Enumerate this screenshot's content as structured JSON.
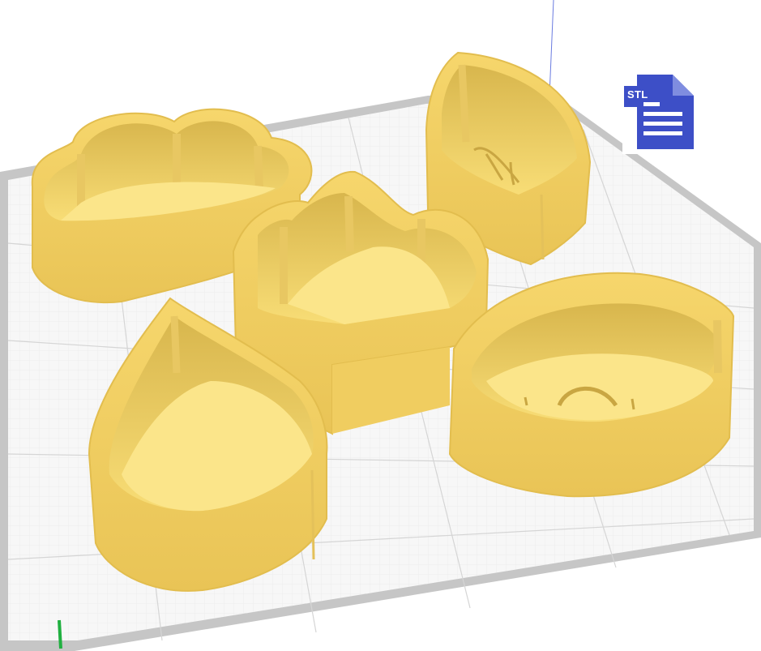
{
  "viewport": {
    "background": "#ffffff",
    "build_plate_color": "#c9c9c9",
    "grid_line_color": "#e8e8e8",
    "model_color": "#f6d66c",
    "model_shadow_color": "#d7b347",
    "axis_colors": {
      "x": "#e03030",
      "y": "#2050e0",
      "z": "#20b040"
    }
  },
  "models": [
    {
      "name": "cloud-cutter"
    },
    {
      "name": "leaf-cutter"
    },
    {
      "name": "tulip-cutter"
    },
    {
      "name": "teardrop-cutter"
    },
    {
      "name": "eye-cutter"
    }
  ],
  "file_badge": {
    "label": "STL",
    "icon": "document-icon",
    "color": "#3d4fc7"
  }
}
